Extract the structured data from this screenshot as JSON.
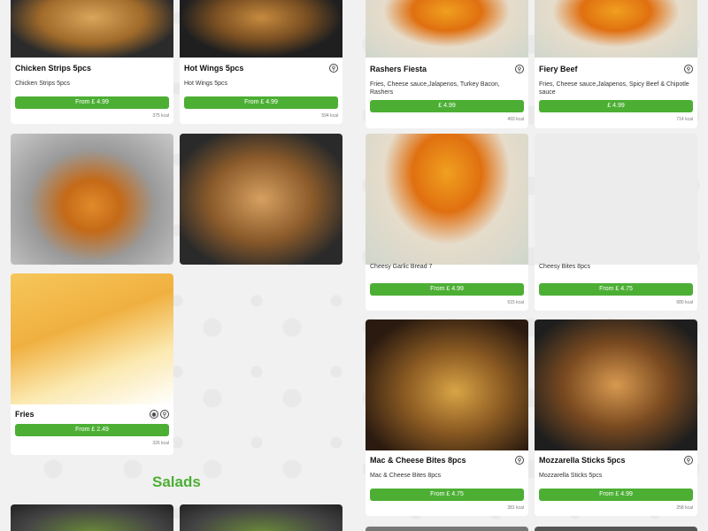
{
  "section": {
    "salads_title": "Salads"
  },
  "items": {
    "chicken_strips": {
      "name": "Chicken Strips 5pcs",
      "desc": "Chicken Strips 5pcs",
      "price": "From £ 4.99",
      "kcal": "375 kcal",
      "photo": "chicken-strips-photo"
    },
    "hot_wings": {
      "name": "Hot Wings 5pcs",
      "desc": "Hot Wings 5pcs",
      "price": "From £ 4.99",
      "kcal": "594 kcal",
      "photo": "hot-wings-photo"
    },
    "rashers_fiesta": {
      "name": "Rashers Fiesta",
      "desc": "Fries, Cheese sauce,Jalapenos, Turkey Bacon, Rashers",
      "price": "£ 4.99",
      "kcal": "493 kcal"
    },
    "fiery_beef": {
      "name": "Fiery Beef",
      "desc": "Fries, Cheese sauce,Jalapenos, Spicy Beef & Chipotle sauce",
      "price": "£ 4.99",
      "kcal": "714 kcal"
    },
    "cheesy_garlic": {
      "name": "Cheesy Garlic Bread 7",
      "price": "From £ 4.99",
      "kcal": "515 kcal"
    },
    "cheesy_bites": {
      "name": "Cheesy Bites 8pcs",
      "price": "From £ 4.75",
      "kcal": "680 kcal"
    },
    "fries": {
      "name": "Fries",
      "price": "From £ 2.49",
      "kcal": "326 kcal"
    },
    "mac_cheese": {
      "name": "Mac & Cheese Bites 8pcs",
      "desc": "Mac & Cheese Bites 8pcs",
      "price": "From £ 4.75",
      "kcal": "381 kcal"
    },
    "mozzarella": {
      "name": "Mozzarella Sticks 5pcs",
      "desc": "Mozzarella Sticks 5pcs",
      "price": "From £ 4.99",
      "kcal": "258 kcal"
    }
  },
  "icons": {
    "veg": "vegetarian-icon",
    "vegan": "vegan-icon"
  }
}
